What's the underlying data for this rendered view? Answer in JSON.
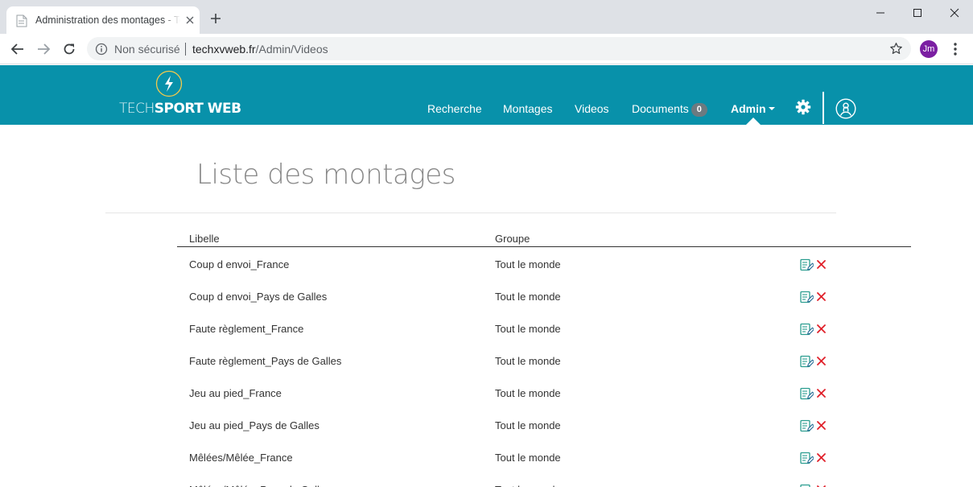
{
  "browser": {
    "tab_title": "Administration des montages - TechSport Web",
    "security_label": "Non sécurisé",
    "url_host": "techxvweb.fr",
    "url_path": "/Admin/Videos",
    "profile_initials": "Jm"
  },
  "header": {
    "logo_light": "TECH",
    "logo_bold": "SPORT WEB",
    "nav": {
      "recherche": "Recherche",
      "montages": "Montages",
      "videos": "Videos",
      "documents": "Documents",
      "documents_count": "0",
      "admin": "Admin"
    },
    "colors": {
      "bar": "#0891aa",
      "accent_logo": "#f2c94c"
    }
  },
  "page": {
    "title": "Liste des montages",
    "columns": {
      "libelle": "Libelle",
      "groupe": "Groupe"
    },
    "rows": [
      {
        "libelle": "Coup d envoi_France",
        "groupe": "Tout le monde"
      },
      {
        "libelle": "Coup d envoi_Pays de Galles",
        "groupe": "Tout le monde"
      },
      {
        "libelle": "Faute règlement_France",
        "groupe": "Tout le monde"
      },
      {
        "libelle": "Faute règlement_Pays de Galles",
        "groupe": "Tout le monde"
      },
      {
        "libelle": "Jeu au pied_France",
        "groupe": "Tout le monde"
      },
      {
        "libelle": "Jeu au pied_Pays de Galles",
        "groupe": "Tout le monde"
      },
      {
        "libelle": "Mêlées/Mêlée_France",
        "groupe": "Tout le monde"
      },
      {
        "libelle": "Mêlées/Mêlée_Pays de Galles",
        "groupe": "Tout le monde"
      }
    ],
    "row_actions": {
      "edit_icon": "edit-icon",
      "delete_icon": "delete-icon",
      "edit_color": "#2a9d8f",
      "delete_color": "#e0202a"
    }
  }
}
